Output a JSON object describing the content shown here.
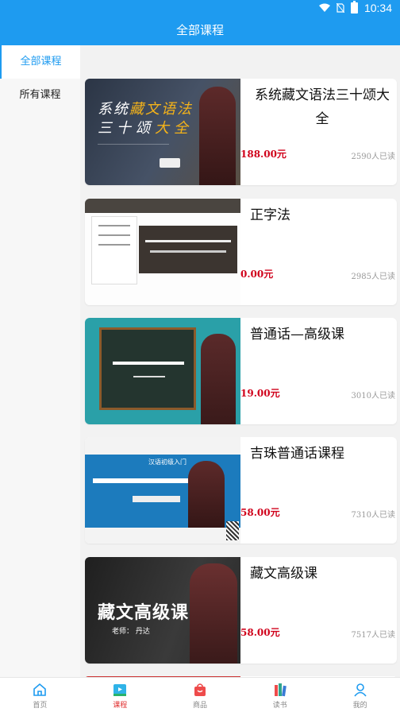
{
  "status_bar": {
    "time": "10:34"
  },
  "header": {
    "title": "全部课程"
  },
  "sidebar": {
    "items": [
      {
        "label": "全部课程",
        "active": true
      },
      {
        "label": "所有课程",
        "active": false
      }
    ]
  },
  "courses": [
    {
      "title": "系统藏文语法三十颂大全",
      "price": "188.00元",
      "reads": "2590人已读",
      "thumb": {
        "line1_a": "系统",
        "line1_b": "藏文语法",
        "line2_a": "三十颂",
        "line2_b": "大全"
      }
    },
    {
      "title": "正字法",
      "price": "0.00元",
      "reads": "2985人已读"
    },
    {
      "title": "普通话—高级课",
      "price": "19.00元",
      "reads": "3010人已读"
    },
    {
      "title": "吉珠普通话课程",
      "price": "58.00元",
      "reads": "7310人已读",
      "thumb": {
        "text": "汉语初级入门"
      }
    },
    {
      "title": "藏文高级课",
      "price": "58.00元",
      "reads": "7517人已读",
      "thumb": {
        "text": "藏文高级课",
        "teacher": "老师：  丹达"
      }
    }
  ],
  "tabbar": {
    "items": [
      {
        "label": "首页",
        "icon": "home-icon",
        "active": false
      },
      {
        "label": "课程",
        "icon": "course-icon",
        "active": true
      },
      {
        "label": "商品",
        "icon": "shop-bag-icon",
        "active": false
      },
      {
        "label": "读书",
        "icon": "books-icon",
        "active": false
      },
      {
        "label": "我的",
        "icon": "profile-icon",
        "active": false
      }
    ]
  },
  "colors": {
    "primary": "#1e9bf0",
    "price": "#d0021b",
    "active_tab": "#e03030"
  }
}
